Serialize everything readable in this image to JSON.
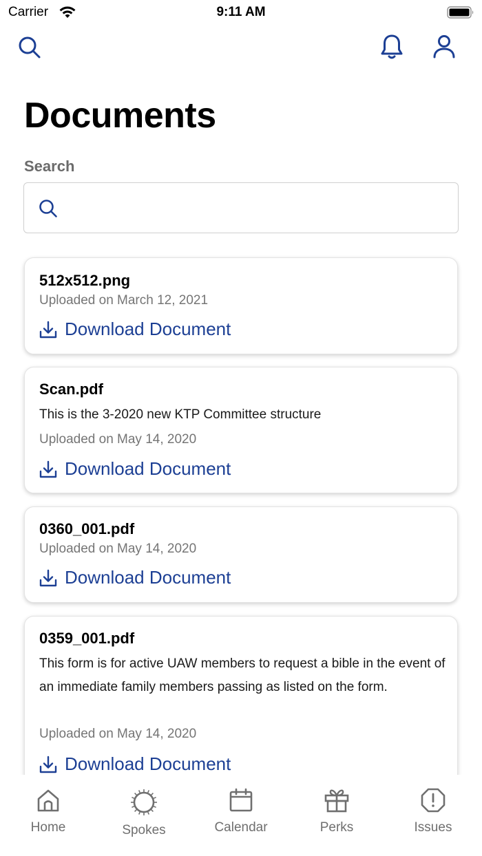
{
  "status_bar": {
    "carrier": "Carrier",
    "time": "9:11 AM"
  },
  "header": {
    "title": "Documents"
  },
  "search": {
    "label": "Search",
    "value": "",
    "placeholder": ""
  },
  "colors": {
    "accent": "#1c3f94",
    "muted_text": "#757575",
    "tab_text": "#6f6f6f"
  },
  "documents": [
    {
      "name": "512x512.png",
      "description": "",
      "uploaded": "Uploaded on March 12, 2021",
      "download_label": "Download Document"
    },
    {
      "name": "Scan.pdf",
      "description": "This is the 3-2020 new KTP Committee structure",
      "uploaded": "Uploaded on May 14, 2020",
      "download_label": "Download Document"
    },
    {
      "name": "0360_001.pdf",
      "description": "",
      "uploaded": "Uploaded on May 14, 2020",
      "download_label": "Download Document"
    },
    {
      "name": "0359_001.pdf",
      "description": "This form is for active UAW members to request a bible in the event of an immediate family members passing as listed on the form.",
      "uploaded": "Uploaded on May 14, 2020",
      "download_label": "Download Document"
    }
  ],
  "tabs": [
    {
      "label": "Home",
      "icon": "home-icon"
    },
    {
      "label": "Spokes",
      "icon": "spokes-icon"
    },
    {
      "label": "Calendar",
      "icon": "calendar-icon"
    },
    {
      "label": "Perks",
      "icon": "gift-icon"
    },
    {
      "label": "Issues",
      "icon": "alert-octagon-icon"
    }
  ]
}
